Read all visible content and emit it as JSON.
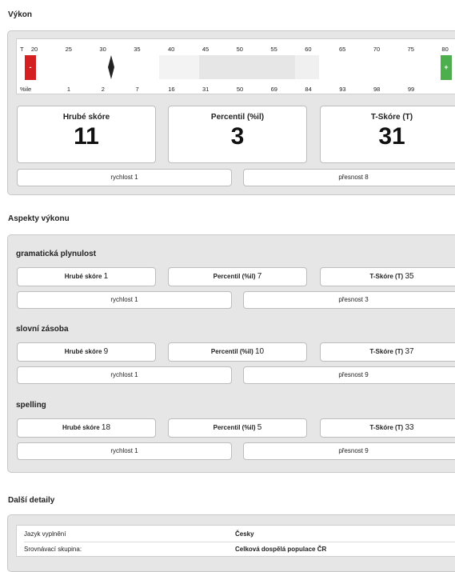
{
  "vykon": {
    "title": "Výkon",
    "scale": {
      "t_prefix": "T",
      "t_ticks": [
        "20",
        "25",
        "30",
        "35",
        "40",
        "45",
        "50",
        "55",
        "60",
        "65",
        "70",
        "75",
        "80"
      ],
      "pct_prefix": "%ile",
      "pct_ticks": [
        "1",
        "2",
        "7",
        "16",
        "31",
        "50",
        "69",
        "84",
        "93",
        "98",
        "99"
      ],
      "minus": "-",
      "plus": "+",
      "needle_t": 31
    },
    "scores": {
      "raw_label": "Hrubé skóre",
      "raw_value": "11",
      "pct_label": "Percentil (%il)",
      "pct_value": "3",
      "t_label": "T-Skóre (T)",
      "t_value": "31"
    },
    "speed": "rychlost 1",
    "accuracy": "přesnost 8"
  },
  "aspekty": {
    "title": "Aspekty výkonu",
    "items": [
      {
        "name": "gramatická plynulost",
        "raw_label": "Hrubé skóre",
        "raw": "1",
        "pct_label": "Percentil (%il)",
        "pct": "7",
        "t_label": "T-Skóre (T)",
        "t": "35",
        "speed": "rychlost 1",
        "accuracy": "přesnost 3"
      },
      {
        "name": "slovní zásoba",
        "raw_label": "Hrubé skóre",
        "raw": "9",
        "pct_label": "Percentil (%il)",
        "pct": "10",
        "t_label": "T-Skóre (T)",
        "t": "37",
        "speed": "rychlost 1",
        "accuracy": "přesnost 9"
      },
      {
        "name": "spelling",
        "raw_label": "Hrubé skóre",
        "raw": "18",
        "pct_label": "Percentil (%il)",
        "pct": "5",
        "t_label": "T-Skóre (T)",
        "t": "33",
        "speed": "rychlost 1",
        "accuracy": "přesnost 9"
      }
    ]
  },
  "dalsi": {
    "title": "Další detaily",
    "rows": [
      {
        "key": "Jazyk vyplnění",
        "value": "Česky"
      },
      {
        "key": "Srovnávací skupina:",
        "value": "Celková dospělá populace ČR"
      }
    ]
  },
  "colors": {
    "minus": "#d42020",
    "plus": "#4cae4c",
    "band": "#f0f0f0",
    "panel": "#e6e6e6"
  }
}
